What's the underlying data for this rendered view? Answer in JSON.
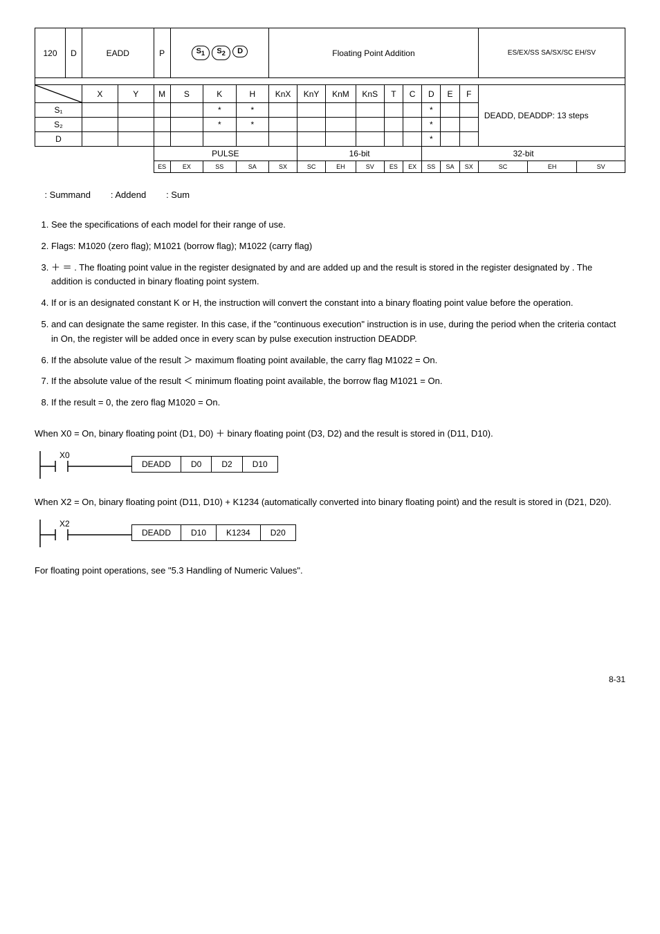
{
  "api": {
    "number": "120",
    "d": "D",
    "name": "EADD",
    "p": "P",
    "desc": "Floating Point Addition",
    "models": "ES/EX/SS SA/SX/SC EH/SV"
  },
  "typeHeader": {
    "cols": [
      "X",
      "Y",
      "M",
      "S",
      "K",
      "H",
      "KnX",
      "KnY",
      "KnM",
      "KnS",
      "T",
      "C",
      "D",
      "E",
      "F"
    ],
    "steps": "DEADD, DEADDP: 13 steps"
  },
  "rows": {
    "s1": "S₁",
    "s2": "S₂",
    "d": "D"
  },
  "pulse": {
    "p": "PULSE",
    "b16": "16-bit",
    "b32": "32-bit",
    "cells": [
      "ES",
      "EX",
      "SS",
      "SA",
      "SX",
      "SC",
      "EH",
      "SV"
    ]
  },
  "operands": {
    "s1": ": Summand",
    "s2": ": Addend",
    "d": ": Sum"
  },
  "explanations": [
    "See the specifications of each model for their range of use.",
    "Flags: M1020 (zero flag); M1021 (borrow flag); M1022 (carry flag)",
    "＋ ＝ . The floating point value in the register designated by  and  are added up and the result is stored in the register designated by . The addition is conducted in binary floating point system.",
    "If  or  is an designated constant K or H, the instruction will convert the constant into a binary floating point value before the operation.",
    " and  can designate the same register. In this case, if the \"continuous execution\" instruction is in use, during the period when the criteria contact in On, the register will be added once in every scan by pulse execution instruction DEADDP.",
    "If the absolute value of the result ＞ maximum floating point available, the carry flag M1022 = On.",
    "If the absolute value of the result ＜ minimum floating point available, the borrow flag M1021 = On.",
    "If the result = 0, the zero flag M1020 = On."
  ],
  "ex1": {
    "text": "When X0 = On, binary floating point (D1, D0) ＋ binary floating point (D3, D2) and the result is stored in (D11, D10).",
    "contact": "X0",
    "inst": [
      "DEADD",
      "D0",
      "D2",
      "D10"
    ]
  },
  "ex2": {
    "text1": "When X2 = On, binary floating point (D11, D10) + K1234 (automatically converted into binary floating point) and the result is stored in (D21, D20).",
    "contact": "X2",
    "inst": [
      "DEADD",
      "D10",
      "K1234",
      "D20"
    ]
  },
  "remarks": "For floating point operations, see \"5.3 Handling of Numeric Values\".",
  "pageNum": "8-31"
}
